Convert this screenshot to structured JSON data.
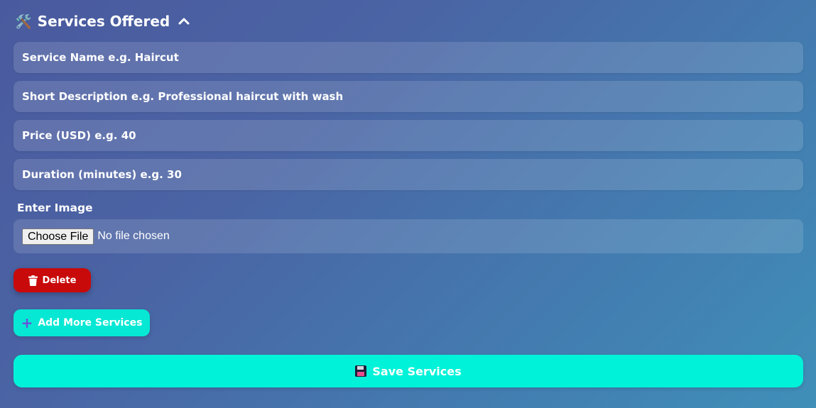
{
  "section": {
    "icon": "🛠️",
    "title": "Services Offered",
    "collapse_icon": "chevron-up-icon"
  },
  "fields": {
    "service_name_placeholder": "Service Name e.g. Haircut",
    "description_placeholder": "Short Description e.g. Professional haircut with wash",
    "price_placeholder": "Price (USD) e.g. 40",
    "duration_placeholder": "Duration (minutes) e.g. 30"
  },
  "image": {
    "label": "Enter Image",
    "choose_label": "Choose File",
    "status": "No file chosen"
  },
  "buttons": {
    "delete_label": "Delete",
    "delete_icon": "trash-icon",
    "add_label": "Add More Services",
    "add_icon": "plus-icon",
    "save_label": "Save Services",
    "save_icon": "floppy-disk-icon"
  },
  "colors": {
    "delete": "#c80a0a",
    "accent": "#00f2d8",
    "plus": "#6b4fd8"
  }
}
